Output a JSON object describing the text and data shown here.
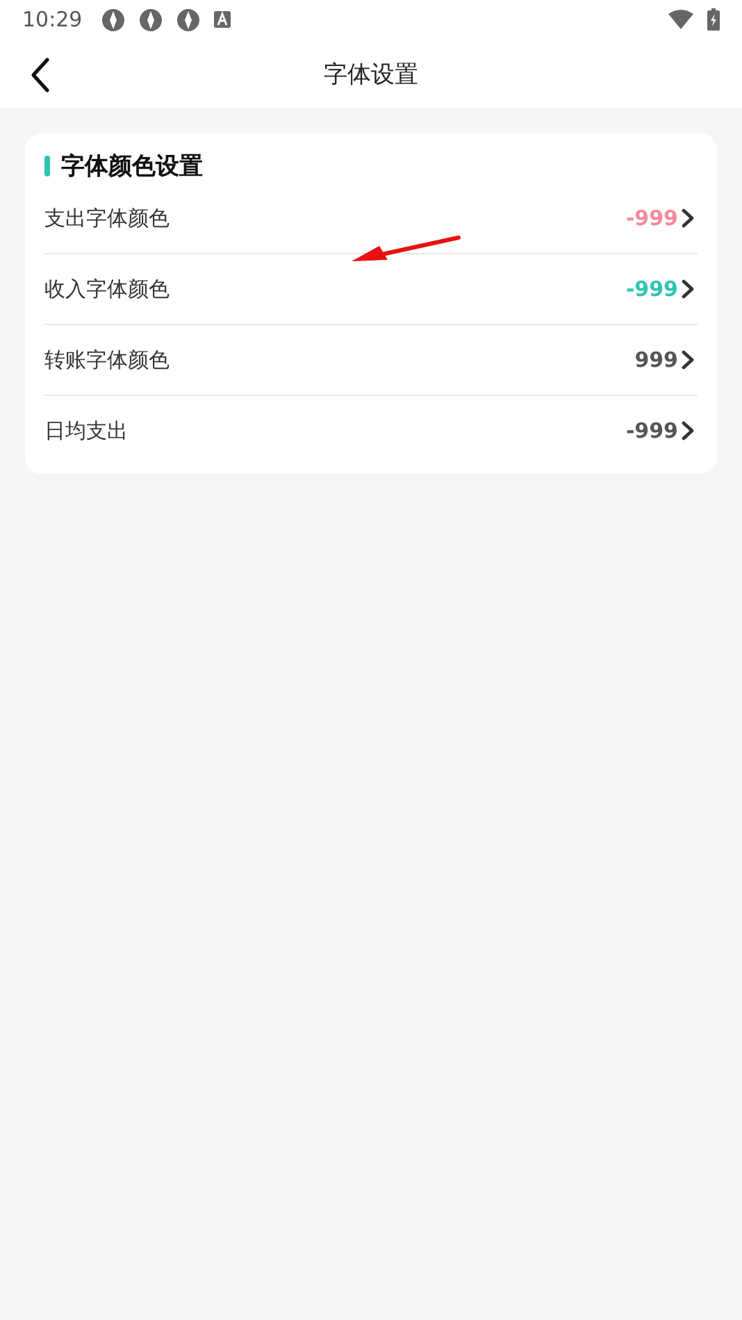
{
  "status_bar": {
    "time": "10:29"
  },
  "header": {
    "title": "字体设置"
  },
  "section": {
    "title": "字体颜色设置",
    "rows": [
      {
        "label": "支出字体颜色",
        "value": "-999",
        "color": "#f38a9c"
      },
      {
        "label": "收入字体颜色",
        "value": "-999",
        "color": "#2ec4b0"
      },
      {
        "label": "转账字体颜色",
        "value": "999",
        "color": "#555555"
      },
      {
        "label": "日均支出",
        "value": "-999",
        "color": "#555555"
      }
    ]
  }
}
